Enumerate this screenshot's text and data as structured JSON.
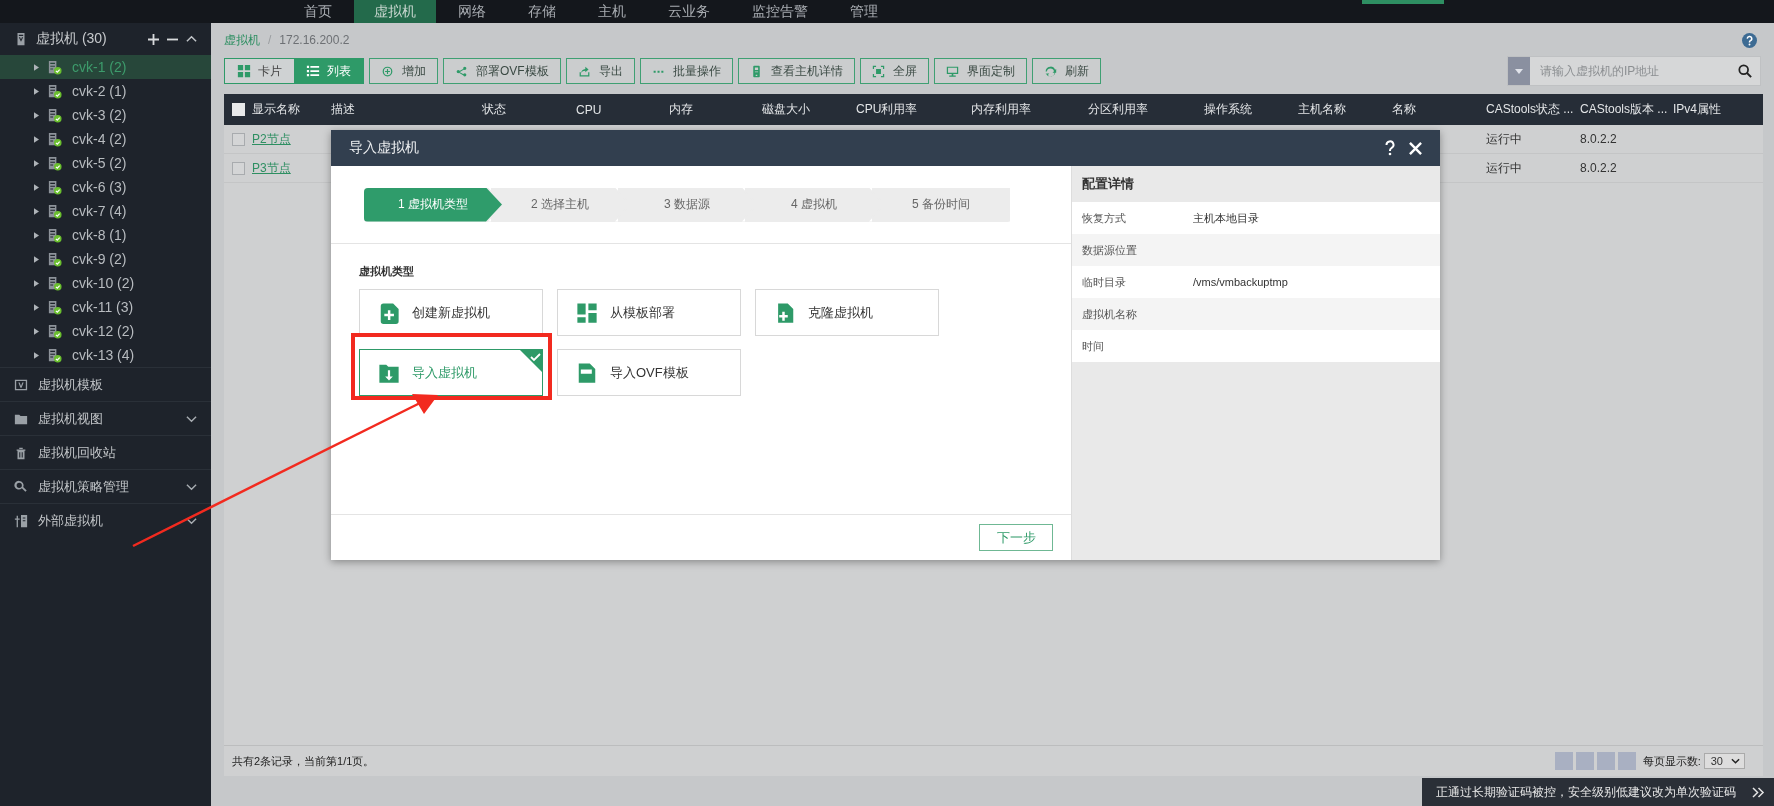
{
  "top_nav": {
    "items": [
      {
        "label": "首页",
        "selected": false
      },
      {
        "label": "虚拟机",
        "selected": true
      },
      {
        "label": "网络",
        "selected": false
      },
      {
        "label": "存储",
        "selected": false
      },
      {
        "label": "主机",
        "selected": false
      },
      {
        "label": "云业务",
        "selected": false
      },
      {
        "label": "监控告警",
        "selected": false
      },
      {
        "label": "管理",
        "selected": false
      }
    ]
  },
  "sidebar": {
    "header": {
      "label": "虚拟机 (30)",
      "expanded": true
    },
    "hosts": [
      {
        "label": "cvk-1 (2)",
        "selected": true
      },
      {
        "label": "cvk-2 (1)",
        "selected": false
      },
      {
        "label": "cvk-3 (2)",
        "selected": false
      },
      {
        "label": "cvk-4 (2)",
        "selected": false
      },
      {
        "label": "cvk-5 (2)",
        "selected": false
      },
      {
        "label": "cvk-6 (3)",
        "selected": false
      },
      {
        "label": "cvk-7 (4)",
        "selected": false
      },
      {
        "label": "cvk-8 (1)",
        "selected": false
      },
      {
        "label": "cvk-9 (2)",
        "selected": false
      },
      {
        "label": "cvk-10 (2)",
        "selected": false
      },
      {
        "label": "cvk-11 (3)",
        "selected": false
      },
      {
        "label": "cvk-12 (2)",
        "selected": false
      },
      {
        "label": "cvk-13 (4)",
        "selected": false
      }
    ],
    "sections": [
      {
        "label": "虚拟机模板",
        "expandable": false
      },
      {
        "label": "虚拟机视图",
        "expandable": true
      },
      {
        "label": "虚拟机回收站",
        "expandable": false
      },
      {
        "label": "虚拟机策略管理",
        "expandable": true
      },
      {
        "label": "外部虚拟机",
        "expandable": true
      }
    ]
  },
  "breadcrumb": [
    "虚拟机",
    "172.16.200.2"
  ],
  "breadcrumb_separator": "/",
  "toolbar": {
    "view_toggle": [
      {
        "label": "卡片",
        "selected": false
      },
      {
        "label": "列表",
        "selected": true
      }
    ],
    "buttons": [
      "增加",
      "部署OVF模板",
      "导出",
      "批量操作",
      "查看主机详情",
      "全屏",
      "界面定制",
      "刷新"
    ]
  },
  "search": {
    "placeholder": "请输入虚拟机的IP地址"
  },
  "table": {
    "all_checked": false,
    "columns": [
      "显示名称",
      "描述",
      "状态",
      "CPU",
      "内存",
      "磁盘大小",
      "CPU利用率",
      "内存利用率",
      "分区利用率",
      "操作系统",
      "主机名称",
      "名称",
      "CAStools状态 ...",
      "CAStools版本 ...",
      "IPv4属性"
    ],
    "rows": [
      {
        "checked": false,
        "name": "P2节点",
        "castools_status": "运行中",
        "castools_version": "8.0.2.2"
      },
      {
        "checked": false,
        "name": "P3节点",
        "castools_status": "运行中",
        "castools_version": "8.0.2.2"
      }
    ]
  },
  "dialog": {
    "title": "导入虚拟机",
    "steps": [
      {
        "label": "1 虚拟机类型",
        "selected": true
      },
      {
        "label": "2 选择主机",
        "selected": false
      },
      {
        "label": "3 数据源",
        "selected": false
      },
      {
        "label": "4 虚拟机",
        "selected": false
      },
      {
        "label": "5 备份时间",
        "selected": false
      }
    ],
    "section_label": "虚拟机类型",
    "options": [
      {
        "label": "创建新虚拟机",
        "selected": false
      },
      {
        "label": "从模板部署",
        "selected": false
      },
      {
        "label": "克隆虚拟机",
        "selected": false
      },
      {
        "label": "导入虚拟机",
        "selected": true
      },
      {
        "label": "导入OVF模板",
        "selected": false
      }
    ],
    "next_button": "下一步",
    "details": {
      "title": "配置详情",
      "rows": [
        {
          "label": "恢复方式",
          "value": "主机本地目录"
        },
        {
          "label": "数据源位置"
        },
        {
          "label": "临时目录",
          "value": "/vms/vmbackuptmp"
        },
        {
          "label": "虚拟机名称"
        },
        {
          "label": "时间"
        }
      ]
    }
  },
  "pagination": {
    "summary": "共有2条记录，当前第1/1页。",
    "page_size_label": "每页显示数:",
    "page_size": "30"
  },
  "toast": {
    "message": "正通过长期验证码被控，安全级别低建议改为单次验证码"
  }
}
